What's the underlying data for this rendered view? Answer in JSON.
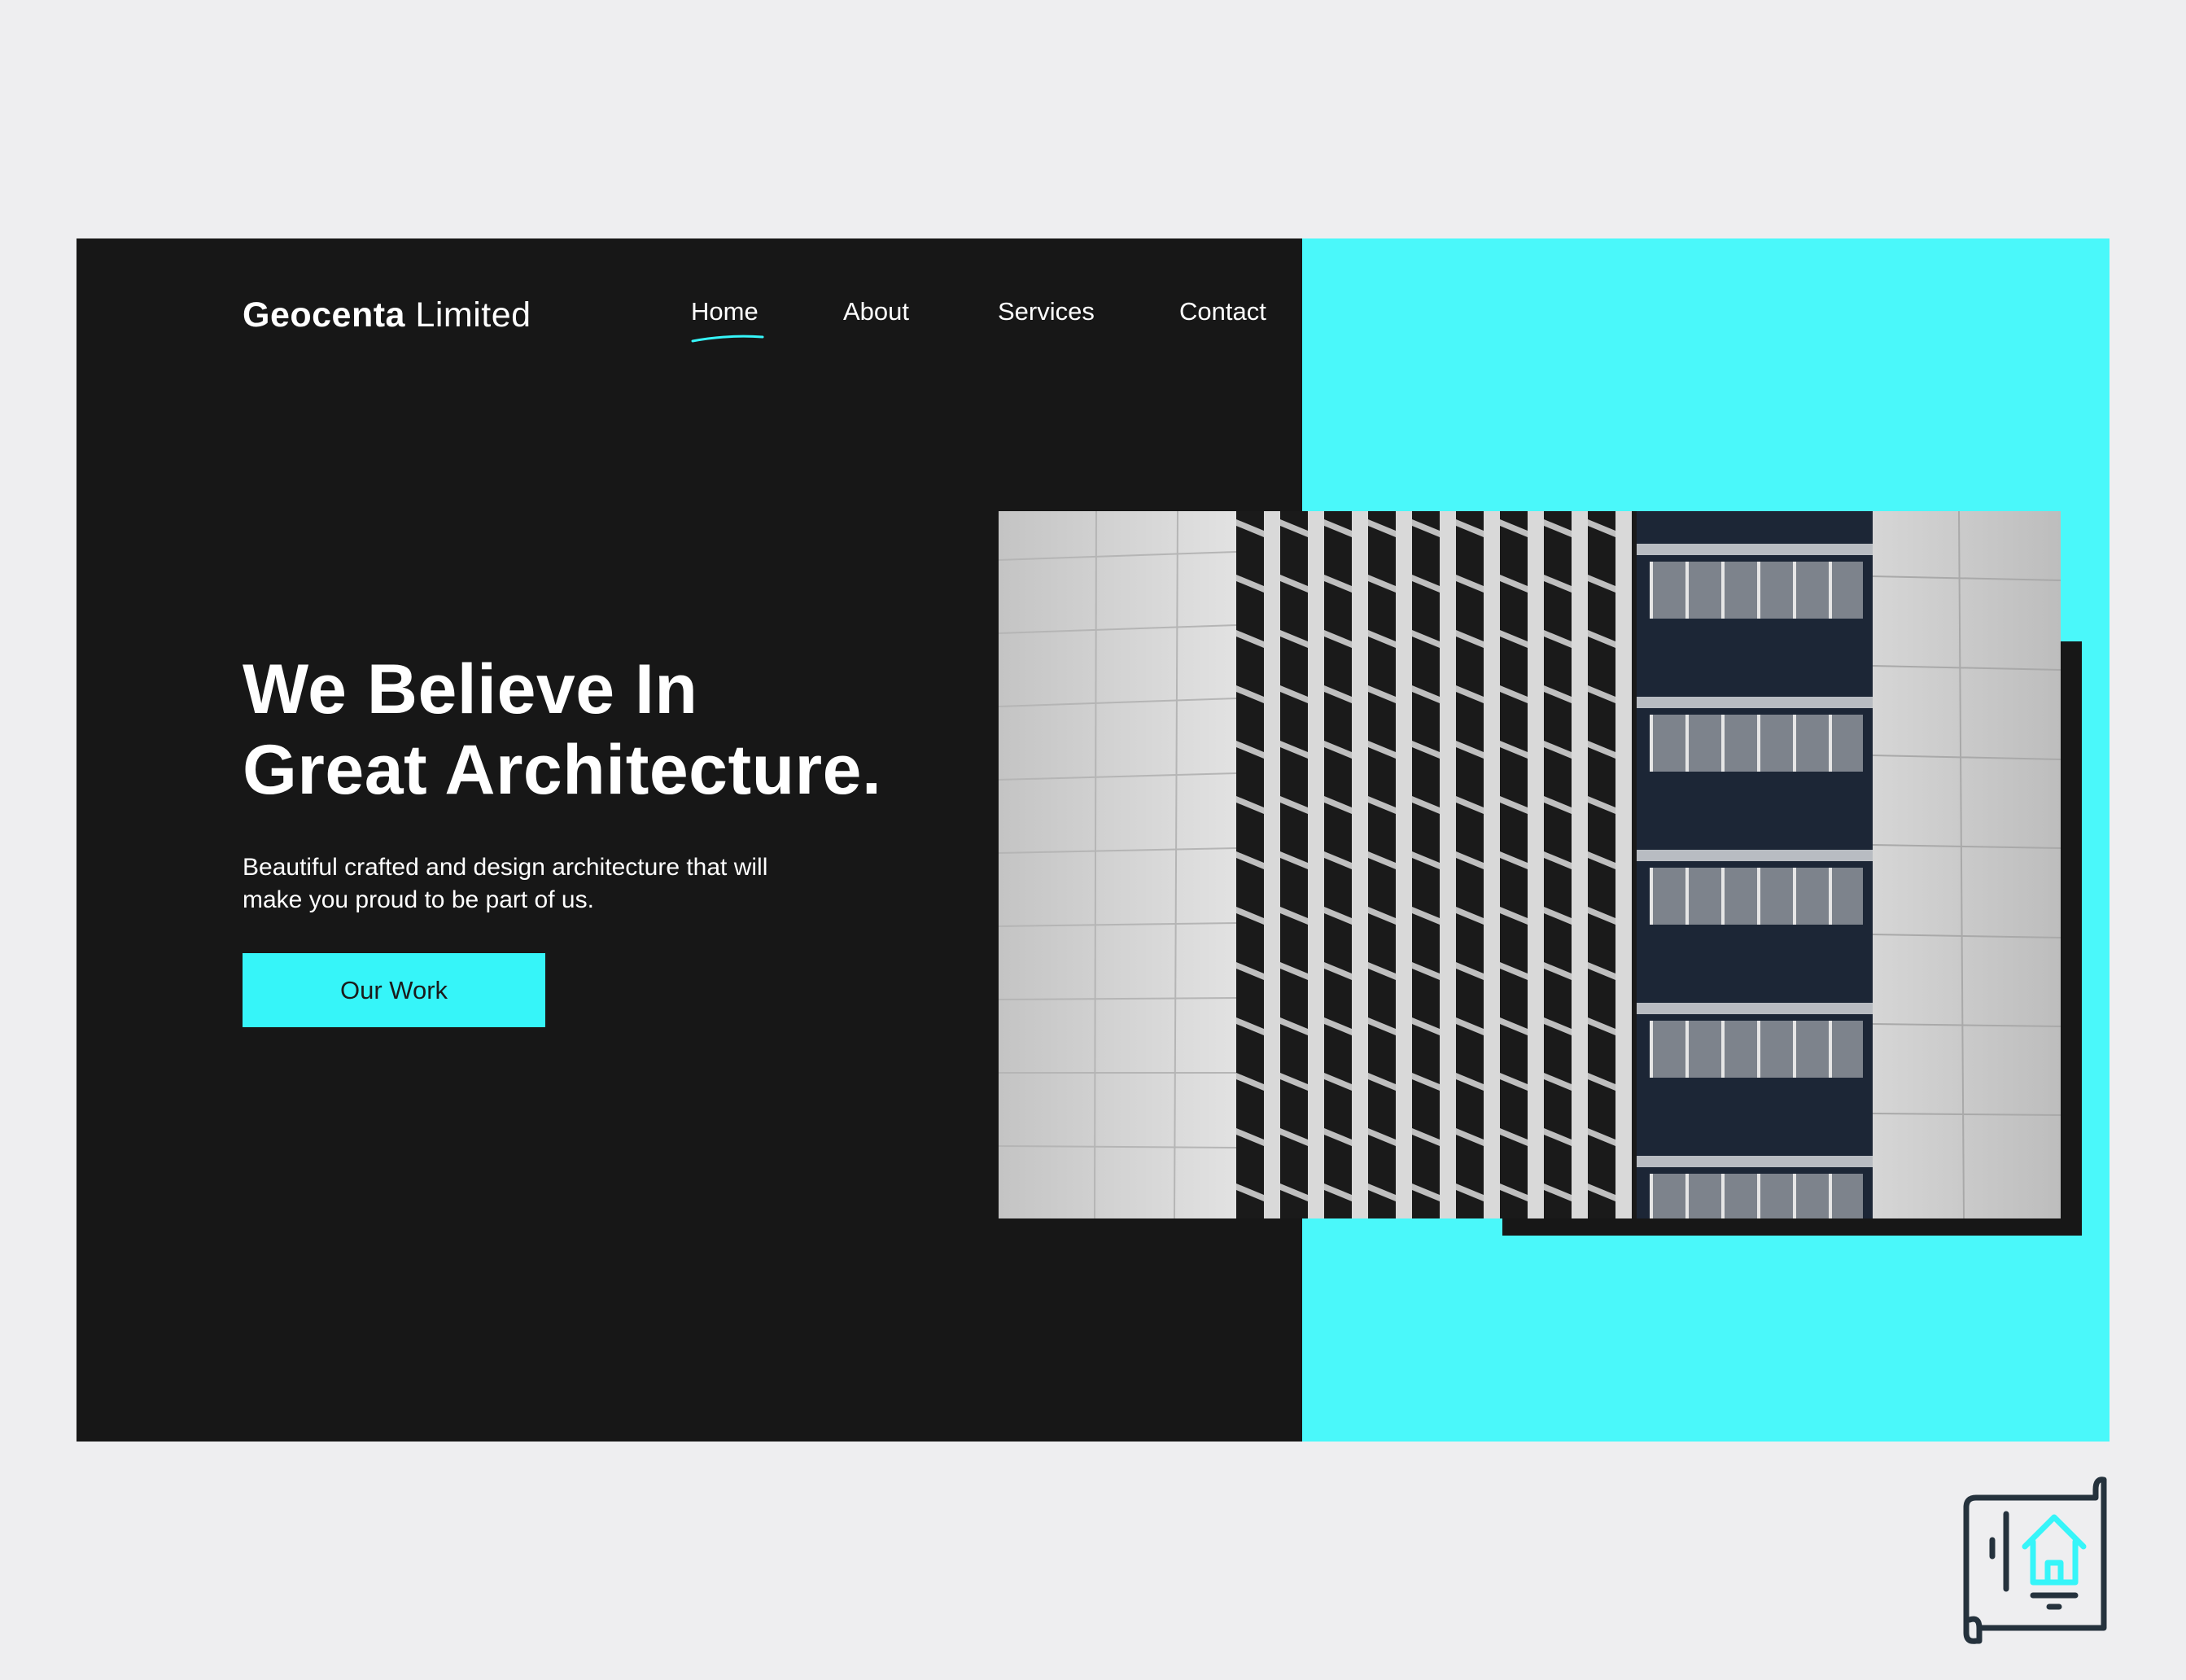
{
  "brand": {
    "name_bold": "Geocenta",
    "name_light": "Limited"
  },
  "nav": {
    "items": [
      {
        "label": "Home",
        "active": true
      },
      {
        "label": "About",
        "active": false
      },
      {
        "label": "Services",
        "active": false
      },
      {
        "label": "Contact",
        "active": false
      }
    ]
  },
  "hero": {
    "title_line1": "We Believe In",
    "title_line2": "Great Architecture.",
    "subtitle_line1": "Beautiful crafted and design architecture that will",
    "subtitle_line2": "make you proud to be part of us.",
    "cta_label": "Our Work"
  },
  "icons": {
    "hero_image": "building-facade-photo",
    "corner": "blueprint-house-icon"
  },
  "colors": {
    "background": "#eeeef0",
    "dark_panel": "#171717",
    "accent_cyan": "#4af8fa",
    "button_cyan": "#36f5f9",
    "text_light": "#ffffff",
    "text_dark": "#1b1b1b",
    "icon_stroke": "#25323d"
  }
}
